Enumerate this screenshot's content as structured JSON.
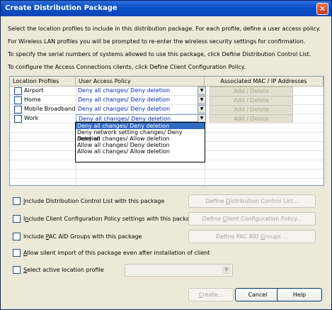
{
  "window": {
    "title": "Create Distribution Package"
  },
  "intro": [
    "Select the location profiles to include in this distribution package. For each profile, define a user access policy.",
    "For Wireless LAN profiles you will be prompted to re-enter the wireless security settings for confirmation.",
    "To specify the serial numbers of systems allowed to use this package, click Define Distribution Control List.",
    "To configure the Access Connections clients, click Define Client Configuration Policy."
  ],
  "table": {
    "headers": [
      "Location Profiles",
      "User Access Policy",
      "Associated MAC / IP Addresses"
    ],
    "rows": [
      {
        "name": "Airport",
        "policy": "Deny all changes/ Deny deletion",
        "action": "Add / Delete"
      },
      {
        "name": "Home",
        "policy": "Deny all changes/ Deny deletion",
        "action": "Add / Delete"
      },
      {
        "name": "Mobile Broadband",
        "policy": "Deny all changes/ Deny deletion",
        "action": "Add / Delete"
      },
      {
        "name": "Work",
        "policy": "Deny all changes/ Deny deletion",
        "action": "Add / Delete"
      }
    ]
  },
  "dropdown": {
    "options": [
      "Deny all changes/ Deny deletion",
      "Deny network setting changes/ Deny deletion",
      "Deny all changes/ Allow deletion",
      "Allow all changes/ Deny deletion",
      "Allow all changes/ Allow deletion"
    ],
    "selected_index": 0
  },
  "options": {
    "dcl": {
      "pre": "",
      "key": "I",
      "post": "nclude Distribution Control List with this package"
    },
    "ccp": {
      "pre": "I",
      "key": "n",
      "post": "clude Client Configuration Policy settings with this package"
    },
    "pac": {
      "pre": "Include ",
      "key": "P",
      "post": "AC AID Groups with this package"
    },
    "silent": {
      "pre": "",
      "key": "A",
      "post": "llow silent import of this package even after installation of client"
    },
    "active": {
      "pre": "",
      "key": "S",
      "post": "elect active location profile"
    }
  },
  "buttons": {
    "dcl": {
      "pre": "Define ",
      "key": "D",
      "post": "istribution Control List..."
    },
    "ccp": {
      "pre": "Define ",
      "key": "C",
      "post": "lient Configuration Policy..."
    },
    "pac": {
      "pre": "Define PAC AID ",
      "key": "G",
      "post": "roups ..."
    },
    "create": {
      "pre": "",
      "key": "C",
      "post": "reate..."
    },
    "cancel": "Cancel",
    "help": "Help"
  },
  "colors": {
    "titlebar": "#0a50c8",
    "policy_text": "#0a2bb0",
    "selection": "#316ac5"
  }
}
